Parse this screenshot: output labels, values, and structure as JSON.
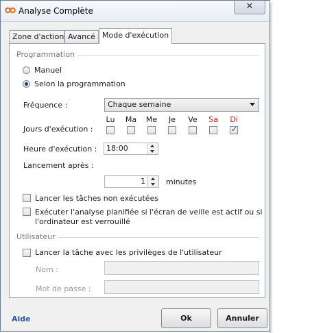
{
  "window": {
    "title": "Analyse Complète",
    "close_label": "✕"
  },
  "tabs": [
    {
      "label": "Zone d'action"
    },
    {
      "label": "Avancé"
    },
    {
      "label": "Mode d'exécution"
    }
  ],
  "programmation": {
    "group_label": "Programmation",
    "manual_label": "Manuel",
    "scheduled_label": "Selon la programmation",
    "frequency_label": "Fréquence :",
    "frequency_value": "Chaque semaine",
    "days_label": "Jours d'exécution :",
    "days": [
      {
        "label": "Lu",
        "checked": false
      },
      {
        "label": "Ma",
        "checked": false
      },
      {
        "label": "Me",
        "checked": false
      },
      {
        "label": "Je",
        "checked": false
      },
      {
        "label": "Ve",
        "checked": false
      },
      {
        "label": "Sa",
        "checked": false
      },
      {
        "label": "Di",
        "checked": true
      }
    ],
    "time_label": "Heure d'exécution :",
    "time_value": "18:00",
    "delay_label": "Lancement après :",
    "delay_value": "1",
    "delay_unit": "minutes",
    "missed_label": "Lancer les tâches non exécutées",
    "screensaver_label_line1": "Exécuter l'analyse planifiée si l'écran de veille est actif ou si",
    "screensaver_label_line2": "l'ordinateur est verrouillé"
  },
  "utilisateur": {
    "group_label": "Utilisateur",
    "privileges_label": "Lancer la tâche avec les privilèges de l'utilisateur",
    "name_label": "Nom :",
    "password_label": "Mot de passe :"
  },
  "footer": {
    "help_label": "Aide",
    "ok_label": "Ok",
    "cancel_label": "Annuler"
  }
}
